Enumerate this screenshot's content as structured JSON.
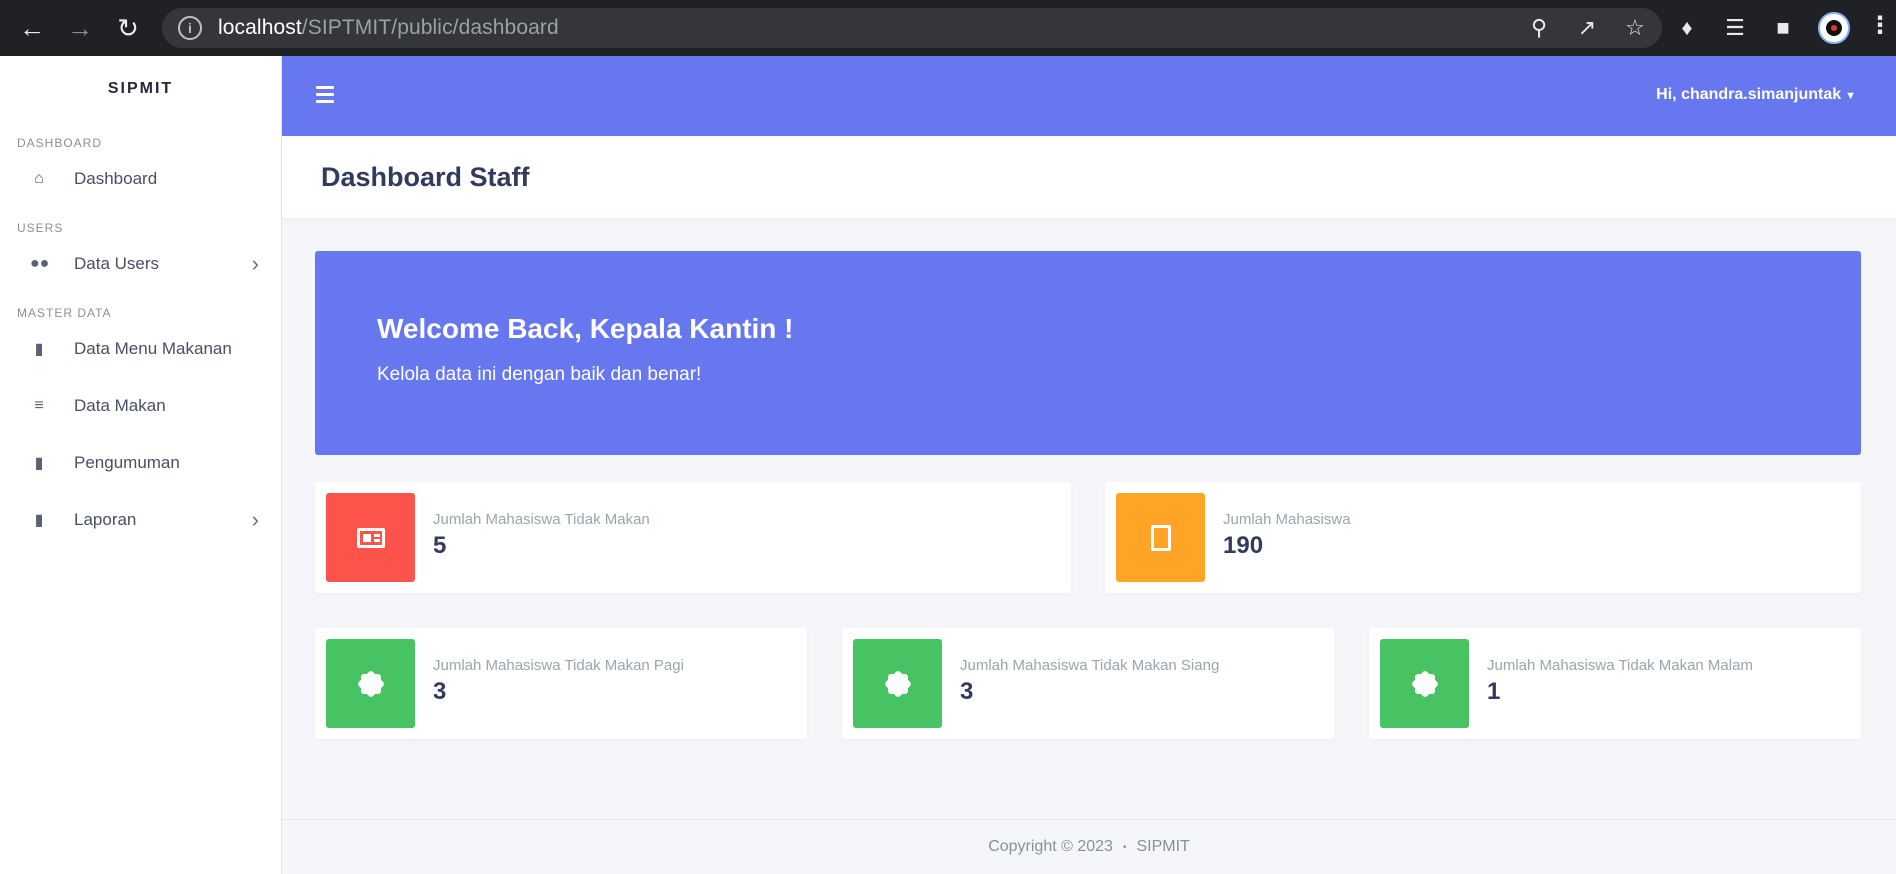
{
  "browser": {
    "url_host": "localhost",
    "url_path": "/SIPTMIT/public/dashboard"
  },
  "sidebar": {
    "brand": "SIPMIT",
    "sections": [
      {
        "label": "DASHBOARD"
      },
      {
        "label": "USERS"
      },
      {
        "label": "MASTER DATA"
      }
    ],
    "items": [
      {
        "label": "Dashboard",
        "icon": "home-icon"
      },
      {
        "label": "Data Users",
        "icon": "users-icon"
      },
      {
        "label": "Data Menu Makanan",
        "icon": "book-icon"
      },
      {
        "label": "Data Makan",
        "icon": "list-icon"
      },
      {
        "label": "Pengumuman",
        "icon": "bookmark-icon"
      },
      {
        "label": "Laporan",
        "icon": "file-icon"
      }
    ]
  },
  "topbar": {
    "user_greeting": "Hi, chandra.simanjuntak"
  },
  "page": {
    "title": "Dashboard Staff"
  },
  "hero": {
    "title": "Welcome Back, Kepala Kantin !",
    "subtitle": "Kelola data ini dengan baik dan benar!"
  },
  "stats": [
    {
      "label": "Jumlah Mahasiswa Tidak Makan",
      "value": "5",
      "color": "#fc544b",
      "icon": "newspaper-icon"
    },
    {
      "label": "Jumlah Mahasiswa",
      "value": "190",
      "color": "#ffa426",
      "icon": "file-icon"
    },
    {
      "label": "Jumlah Mahasiswa Tidak Makan Pagi",
      "value": "3",
      "color": "#47c363",
      "icon": "certificate-icon"
    },
    {
      "label": "Jumlah Mahasiswa Tidak Makan Siang",
      "value": "3",
      "color": "#47c363",
      "icon": "certificate-icon"
    },
    {
      "label": "Jumlah Mahasiswa Tidak Makan Malam",
      "value": "1",
      "color": "#47c363",
      "icon": "certificate-icon"
    }
  ],
  "footer": {
    "copyright": "Copyright © 2023",
    "separator": "•",
    "app": "SIPMIT"
  },
  "colors": {
    "primary": "#6777ef",
    "danger": "#fc544b",
    "warning": "#ffa426",
    "success": "#47c363"
  }
}
